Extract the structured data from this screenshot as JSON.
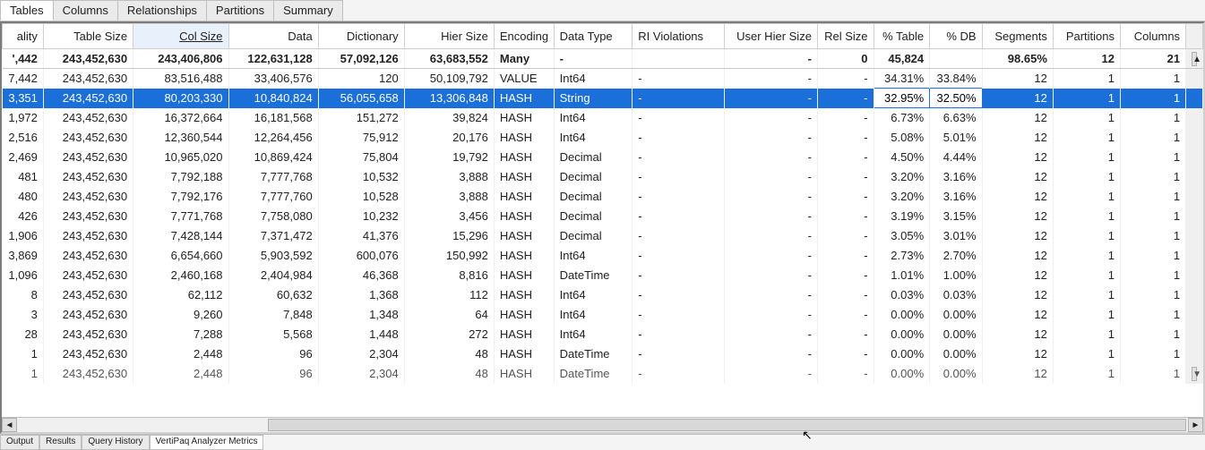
{
  "top_tabs": [
    "Tables",
    "Columns",
    "Relationships",
    "Partitions",
    "Summary"
  ],
  "top_active_index": 0,
  "columns": [
    {
      "key": "ality",
      "label": "ality",
      "class": "col-ality",
      "align": "r"
    },
    {
      "key": "table_size",
      "label": "Table Size",
      "class": "col-tablesize",
      "align": "r"
    },
    {
      "key": "col_size",
      "label": "Col Size",
      "class": "col-colsize",
      "align": "r",
      "sorted": true
    },
    {
      "key": "data",
      "label": "Data",
      "class": "col-data",
      "align": "r"
    },
    {
      "key": "dictionary",
      "label": "Dictionary",
      "class": "col-dict",
      "align": "r"
    },
    {
      "key": "hier_size",
      "label": "Hier Size",
      "class": "col-hier",
      "align": "r"
    },
    {
      "key": "encoding",
      "label": "Encoding",
      "class": "col-enc",
      "align": "l"
    },
    {
      "key": "data_type",
      "label": "Data Type",
      "class": "col-dtype",
      "align": "l"
    },
    {
      "key": "ri_violations",
      "label": "RI Violations",
      "class": "col-riviol",
      "align": "l"
    },
    {
      "key": "user_hier_size",
      "label": "User Hier Size",
      "class": "col-userhier",
      "align": "r"
    },
    {
      "key": "rel_size",
      "label": "Rel Size",
      "class": "col-relsize",
      "align": "r"
    },
    {
      "key": "pct_table",
      "label": "% Table",
      "class": "col-pcttable",
      "align": "r"
    },
    {
      "key": "pct_db",
      "label": "% DB",
      "class": "col-pctdb",
      "align": "r"
    },
    {
      "key": "segments",
      "label": "Segments",
      "class": "col-segments",
      "align": "r"
    },
    {
      "key": "partitions",
      "label": "Partitions",
      "class": "col-partitions",
      "align": "r"
    },
    {
      "key": "columns",
      "label": "Columns",
      "class": "col-columns",
      "align": "r"
    }
  ],
  "rows": [
    {
      "kind": "totals",
      "ality": "',442",
      "table_size": "243,452,630",
      "col_size": "243,406,806",
      "data": "122,631,128",
      "dictionary": "57,092,126",
      "hier_size": "63,683,552",
      "encoding": "Many",
      "data_type": "-",
      "ri_violations": "",
      "user_hier_size": "-",
      "rel_size": "0",
      "pct_table": "45,824",
      "pct_db": "",
      "segments": "98.65%",
      "partitions": "12",
      "columns_v": "1",
      "extra": "21"
    },
    {
      "ality": "7,442",
      "table_size": "243,452,630",
      "col_size": "83,516,488",
      "data": "33,406,576",
      "dictionary": "120",
      "hier_size": "50,109,792",
      "encoding": "VALUE",
      "data_type": "Int64",
      "ri_violations": "-",
      "user_hier_size": "-",
      "rel_size": "-",
      "pct_table": "34.31%",
      "pct_db": "33.84%",
      "segments": "12",
      "partitions": "1",
      "columns_v": "1"
    },
    {
      "kind": "selected",
      "ality": "3,351",
      "table_size": "243,452,630",
      "col_size": "80,203,330",
      "data": "10,840,824",
      "dictionary": "56,055,658",
      "hier_size": "13,306,848",
      "encoding": "HASH",
      "data_type": "String",
      "ri_violations": "-",
      "user_hier_size": "-",
      "rel_size": "-",
      "pct_table": "32.95%",
      "pct_db": "32.50%",
      "segments": "12",
      "partitions": "1",
      "columns_v": "1"
    },
    {
      "ality": "1,972",
      "table_size": "243,452,630",
      "col_size": "16,372,664",
      "data": "16,181,568",
      "dictionary": "151,272",
      "hier_size": "39,824",
      "encoding": "HASH",
      "data_type": "Int64",
      "ri_violations": "-",
      "user_hier_size": "-",
      "rel_size": "-",
      "pct_table": "6.73%",
      "pct_db": "6.63%",
      "segments": "12",
      "partitions": "1",
      "columns_v": "1"
    },
    {
      "ality": "2,516",
      "table_size": "243,452,630",
      "col_size": "12,360,544",
      "data": "12,264,456",
      "dictionary": "75,912",
      "hier_size": "20,176",
      "encoding": "HASH",
      "data_type": "Int64",
      "ri_violations": "-",
      "user_hier_size": "-",
      "rel_size": "-",
      "pct_table": "5.08%",
      "pct_db": "5.01%",
      "segments": "12",
      "partitions": "1",
      "columns_v": "1"
    },
    {
      "ality": "2,469",
      "table_size": "243,452,630",
      "col_size": "10,965,020",
      "data": "10,869,424",
      "dictionary": "75,804",
      "hier_size": "19,792",
      "encoding": "HASH",
      "data_type": "Decimal",
      "ri_violations": "-",
      "user_hier_size": "-",
      "rel_size": "-",
      "pct_table": "4.50%",
      "pct_db": "4.44%",
      "segments": "12",
      "partitions": "1",
      "columns_v": "1"
    },
    {
      "ality": "481",
      "table_size": "243,452,630",
      "col_size": "7,792,188",
      "data": "7,777,768",
      "dictionary": "10,532",
      "hier_size": "3,888",
      "encoding": "HASH",
      "data_type": "Decimal",
      "ri_violations": "-",
      "user_hier_size": "-",
      "rel_size": "-",
      "pct_table": "3.20%",
      "pct_db": "3.16%",
      "segments": "12",
      "partitions": "1",
      "columns_v": "1"
    },
    {
      "ality": "480",
      "table_size": "243,452,630",
      "col_size": "7,792,176",
      "data": "7,777,760",
      "dictionary": "10,528",
      "hier_size": "3,888",
      "encoding": "HASH",
      "data_type": "Decimal",
      "ri_violations": "-",
      "user_hier_size": "-",
      "rel_size": "-",
      "pct_table": "3.20%",
      "pct_db": "3.16%",
      "segments": "12",
      "partitions": "1",
      "columns_v": "1"
    },
    {
      "ality": "426",
      "table_size": "243,452,630",
      "col_size": "7,771,768",
      "data": "7,758,080",
      "dictionary": "10,232",
      "hier_size": "3,456",
      "encoding": "HASH",
      "data_type": "Decimal",
      "ri_violations": "-",
      "user_hier_size": "-",
      "rel_size": "-",
      "pct_table": "3.19%",
      "pct_db": "3.15%",
      "segments": "12",
      "partitions": "1",
      "columns_v": "1"
    },
    {
      "ality": "1,906",
      "table_size": "243,452,630",
      "col_size": "7,428,144",
      "data": "7,371,472",
      "dictionary": "41,376",
      "hier_size": "15,296",
      "encoding": "HASH",
      "data_type": "Decimal",
      "ri_violations": "-",
      "user_hier_size": "-",
      "rel_size": "-",
      "pct_table": "3.05%",
      "pct_db": "3.01%",
      "segments": "12",
      "partitions": "1",
      "columns_v": "1"
    },
    {
      "ality": "3,869",
      "table_size": "243,452,630",
      "col_size": "6,654,660",
      "data": "5,903,592",
      "dictionary": "600,076",
      "hier_size": "150,992",
      "encoding": "HASH",
      "data_type": "Int64",
      "ri_violations": "-",
      "user_hier_size": "-",
      "rel_size": "-",
      "pct_table": "2.73%",
      "pct_db": "2.70%",
      "segments": "12",
      "partitions": "1",
      "columns_v": "1"
    },
    {
      "ality": "1,096",
      "table_size": "243,452,630",
      "col_size": "2,460,168",
      "data": "2,404,984",
      "dictionary": "46,368",
      "hier_size": "8,816",
      "encoding": "HASH",
      "data_type": "DateTime",
      "ri_violations": "-",
      "user_hier_size": "-",
      "rel_size": "-",
      "pct_table": "1.01%",
      "pct_db": "1.00%",
      "segments": "12",
      "partitions": "1",
      "columns_v": "1"
    },
    {
      "ality": "8",
      "table_size": "243,452,630",
      "col_size": "62,112",
      "data": "60,632",
      "dictionary": "1,368",
      "hier_size": "112",
      "encoding": "HASH",
      "data_type": "Int64",
      "ri_violations": "-",
      "user_hier_size": "-",
      "rel_size": "-",
      "pct_table": "0.03%",
      "pct_db": "0.03%",
      "segments": "12",
      "partitions": "1",
      "columns_v": "1"
    },
    {
      "ality": "3",
      "table_size": "243,452,630",
      "col_size": "9,260",
      "data": "7,848",
      "dictionary": "1,348",
      "hier_size": "64",
      "encoding": "HASH",
      "data_type": "Int64",
      "ri_violations": "-",
      "user_hier_size": "-",
      "rel_size": "-",
      "pct_table": "0.00%",
      "pct_db": "0.00%",
      "segments": "12",
      "partitions": "1",
      "columns_v": "1"
    },
    {
      "ality": "28",
      "table_size": "243,452,630",
      "col_size": "7,288",
      "data": "5,568",
      "dictionary": "1,448",
      "hier_size": "272",
      "encoding": "HASH",
      "data_type": "Int64",
      "ri_violations": "-",
      "user_hier_size": "-",
      "rel_size": "-",
      "pct_table": "0.00%",
      "pct_db": "0.00%",
      "segments": "12",
      "partitions": "1",
      "columns_v": "1"
    },
    {
      "ality": "1",
      "table_size": "243,452,630",
      "col_size": "2,448",
      "data": "96",
      "dictionary": "2,304",
      "hier_size": "48",
      "encoding": "HASH",
      "data_type": "DateTime",
      "ri_violations": "-",
      "user_hier_size": "-",
      "rel_size": "-",
      "pct_table": "0.00%",
      "pct_db": "0.00%",
      "segments": "12",
      "partitions": "1",
      "columns_v": "1"
    },
    {
      "kind": "partial",
      "ality": "1",
      "table_size": "243,452,630",
      "col_size": "2,448",
      "data": "96",
      "dictionary": "2,304",
      "hier_size": "48",
      "encoding": "HASH",
      "data_type": "DateTime",
      "ri_violations": "-",
      "user_hier_size": "-",
      "rel_size": "-",
      "pct_table": "0.00%",
      "pct_db": "0.00%",
      "segments": "12",
      "partitions": "1",
      "columns_v": "1"
    }
  ],
  "bottom_tabs": [
    "Output",
    "Results",
    "Query History",
    "VertiPaq Analyzer Metrics"
  ],
  "bottom_active_index": 3
}
